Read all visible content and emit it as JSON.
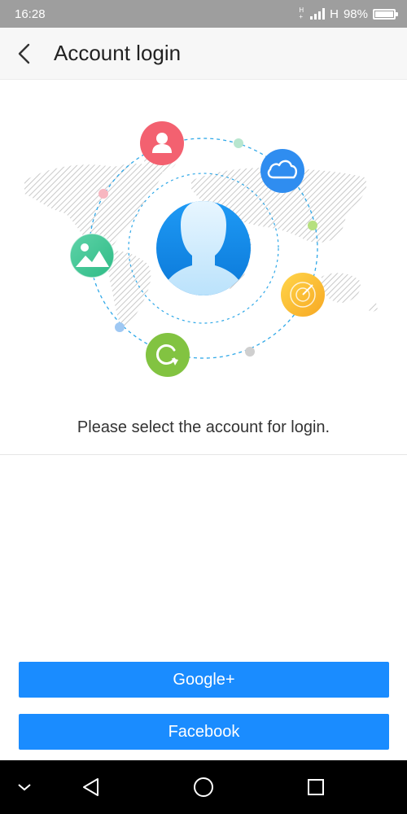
{
  "status_bar": {
    "time": "16:28",
    "network_type": "H",
    "network_small": "H+",
    "battery_percent": "98%",
    "battery_level": 0.98
  },
  "header": {
    "title": "Account login",
    "back_icon": "chevron-left-icon"
  },
  "illustration": {
    "center_icon": "user-avatar-icon",
    "orbit_icons": [
      "person-icon",
      "cloud-icon",
      "gallery-icon",
      "radar-icon",
      "refresh-icon"
    ]
  },
  "prompt": "Please select the account for login.",
  "buttons": {
    "google": "Google+",
    "facebook": "Facebook"
  },
  "nav": {
    "icons": [
      "chevron-down-icon",
      "back-triangle-icon",
      "home-circle-icon",
      "recents-square-icon"
    ]
  },
  "colors": {
    "primary": "#1a8cff",
    "status_bar": "#9e9e9e",
    "nav_bar": "#000000"
  }
}
